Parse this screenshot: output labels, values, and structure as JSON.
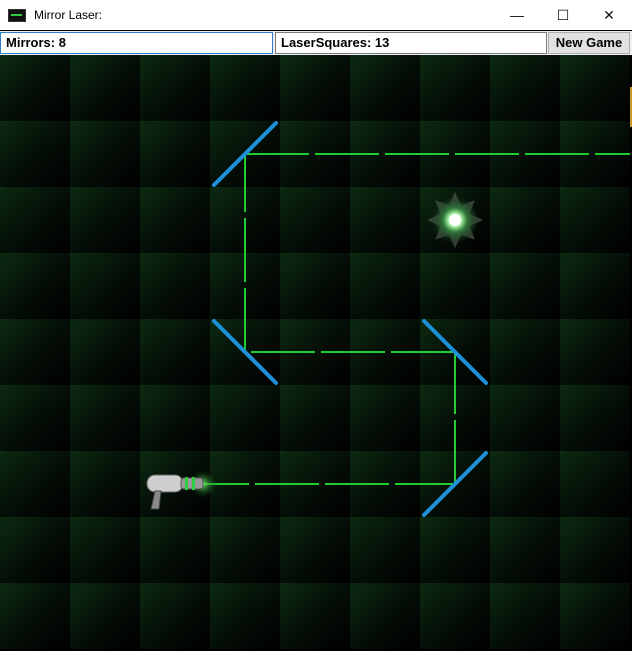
{
  "window": {
    "title": "Mirror Laser:"
  },
  "controls": {
    "minimize": "—",
    "maximize": "☐",
    "close": "✕"
  },
  "toolbar": {
    "mirrors_label": "Mirrors: 8",
    "laser_squares_label": "LaserSquares: 13",
    "new_game_label": "New Game"
  },
  "board": {
    "columns": 9,
    "rows": 9,
    "colors": {
      "background": "#000000",
      "tile_glow": "#0c2a12",
      "laser": "#22cc33",
      "mirror": "#1e90d8"
    },
    "laser_gun": {
      "col": 2,
      "row": 6,
      "icon": "laser-gun-icon"
    },
    "target": {
      "col": 6,
      "row": 2,
      "icon": "burst-target-icon"
    },
    "mirrors": [
      {
        "col": 3,
        "row": 1,
        "orientation": "/"
      },
      {
        "col": 3,
        "row": 4,
        "orientation": "\\"
      },
      {
        "col": 6,
        "row": 4,
        "orientation": "\\"
      },
      {
        "col": 6,
        "row": 6,
        "orientation": "/"
      }
    ],
    "laser_path": [
      {
        "col": 2,
        "row": 6
      },
      {
        "col": 6,
        "row": 6
      },
      {
        "col": 6,
        "row": 4
      },
      {
        "col": 3,
        "row": 4
      },
      {
        "col": 3,
        "row": 1
      },
      {
        "col": 9,
        "row": 1
      }
    ]
  }
}
